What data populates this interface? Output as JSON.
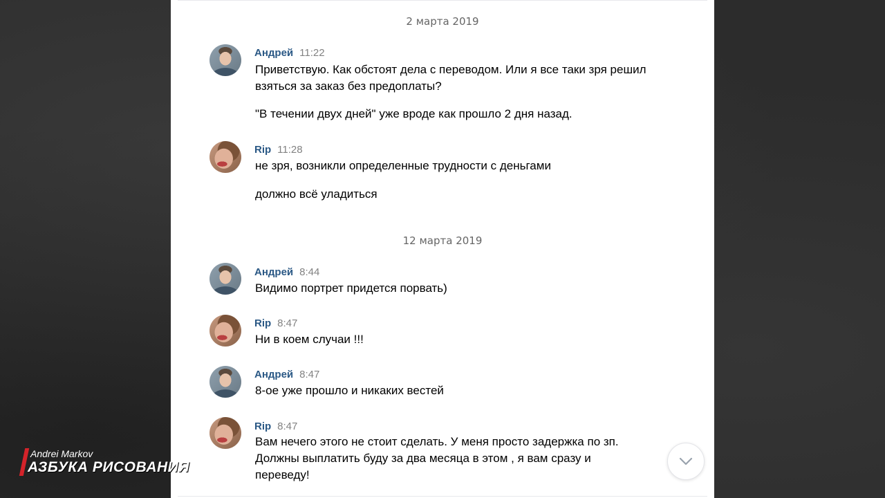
{
  "dates": [
    "2 марта 2019",
    "12 марта 2019"
  ],
  "messages": [
    {
      "author": "Андрей",
      "time": "11:22",
      "lines": [
        "Приветствую. Как обстоят дела с переводом. Или я все таки зря решил взяться за заказ без предоплаты?",
        "\"В течении двух дней\" уже вроде как прошло 2 дня назад."
      ]
    },
    {
      "author": "Rip",
      "time": "11:28",
      "lines": [
        "не зря, возникли определенные трудности с деньгами",
        "должно всё уладиться"
      ]
    },
    {
      "author": "Андрей",
      "time": "8:44",
      "lines": [
        "Видимо портрет придется порвать)"
      ]
    },
    {
      "author": "Rip",
      "time": "8:47",
      "lines": [
        "Ни в коем случаи !!!"
      ]
    },
    {
      "author": "Андрей",
      "time": "8:47",
      "lines": [
        "8-ое уже прошло и никаких вестей"
      ]
    },
    {
      "author": "Rip",
      "time": "8:47",
      "lines": [
        "Вам нечего этого не стоит сделать. У меня просто задержка по зп. Должны выплатить буду за два месяца в этом , я вам сразу и переведу!"
      ]
    }
  ],
  "watermark": {
    "author": "Andrei Markov",
    "title": "АЗБУКА РИСОВАНИЯ"
  },
  "icons": {
    "scroll_down": "chevron-down-icon"
  },
  "colors": {
    "author_link": "#2a5885",
    "time": "#828282",
    "background": "#2c2c2c",
    "watermark_accent": "#d4232a"
  }
}
